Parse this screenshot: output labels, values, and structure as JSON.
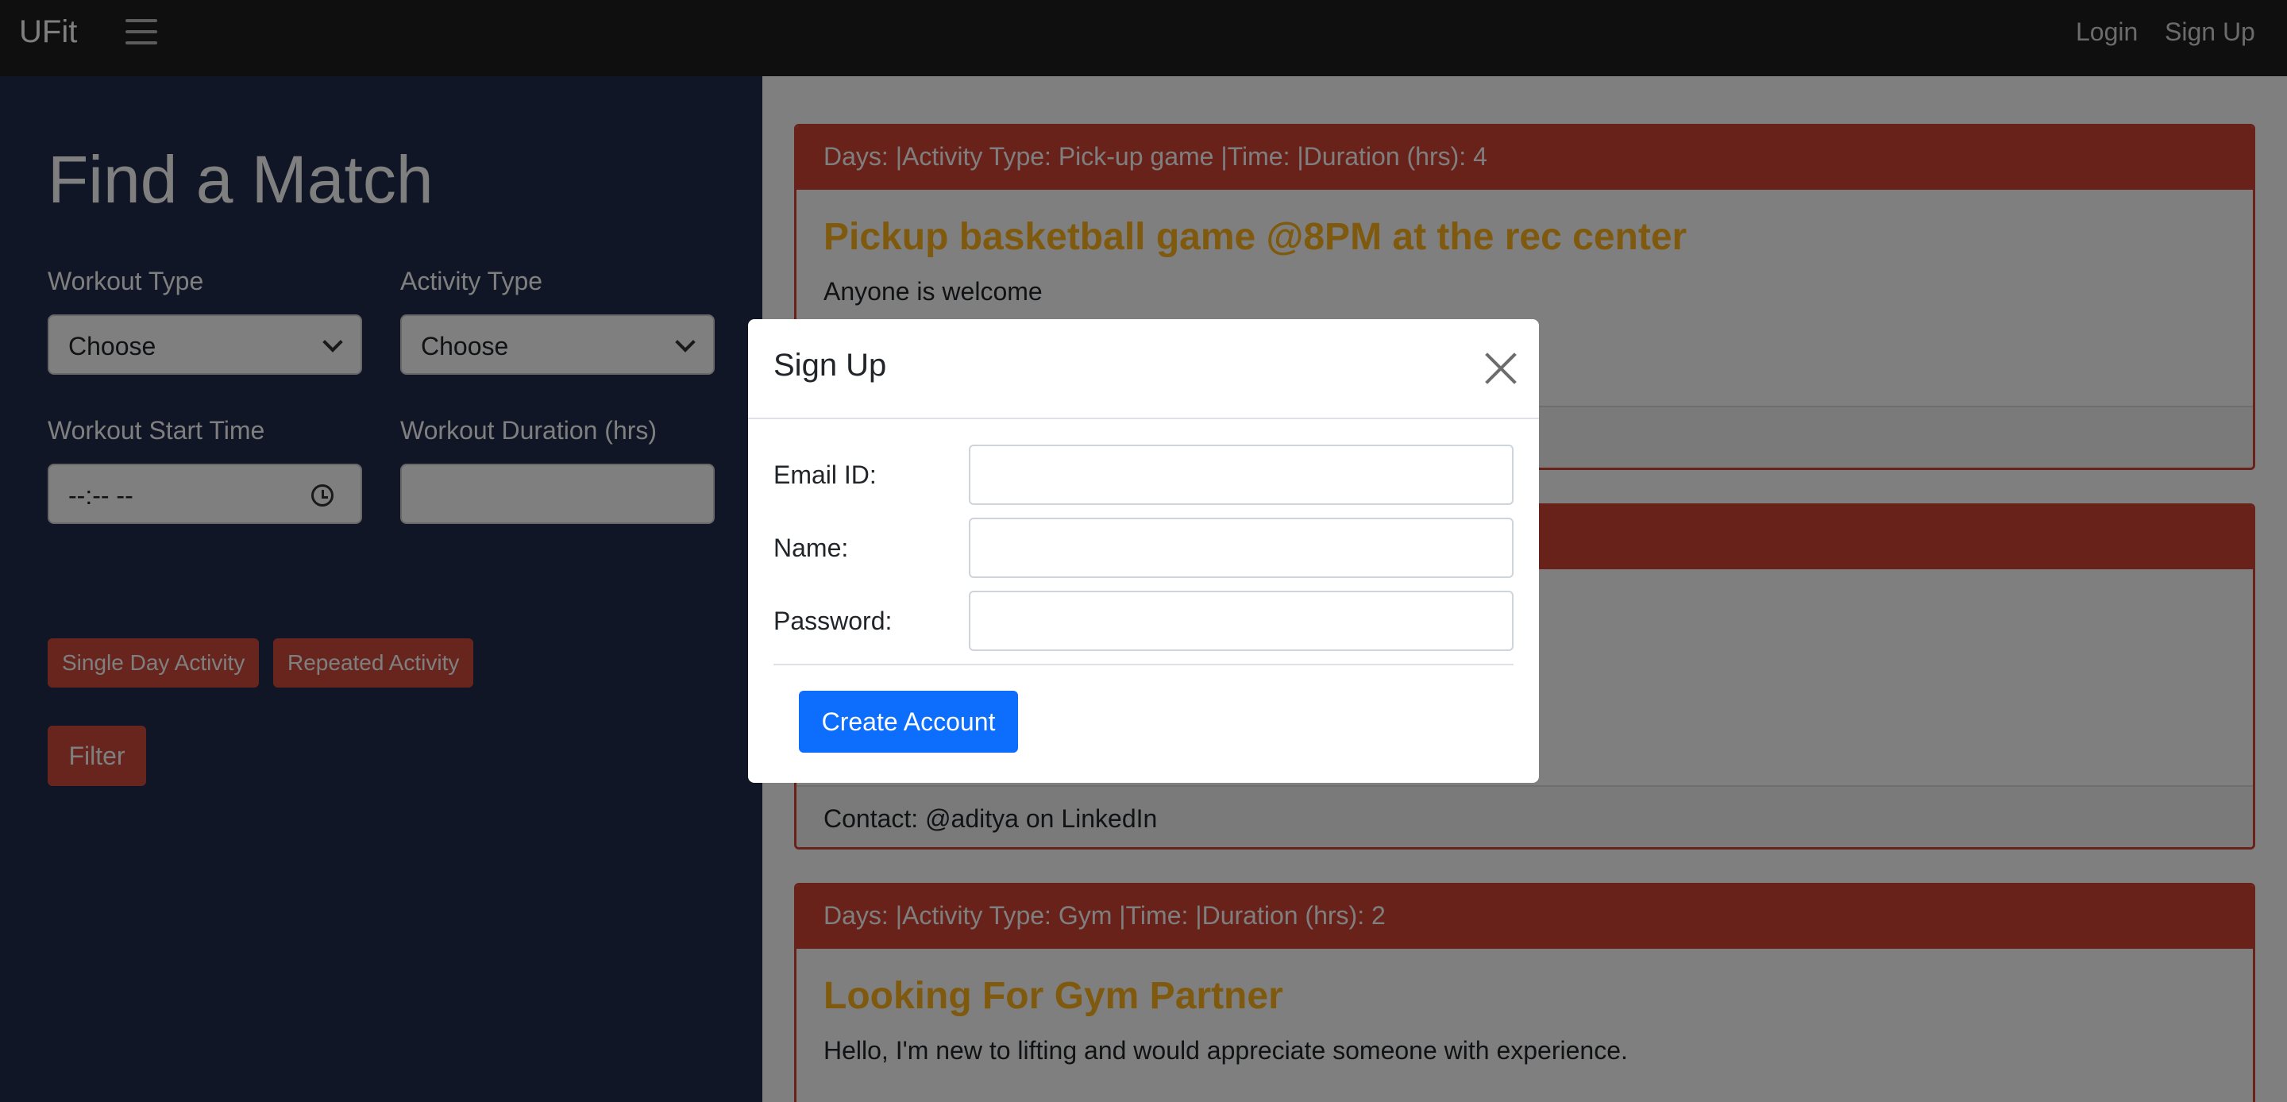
{
  "navbar": {
    "brand": "UFit",
    "login": "Login",
    "signup": "Sign Up"
  },
  "sidebar": {
    "title": "Find a Match",
    "workout_type_label": "Workout Type",
    "workout_type_value": "Choose",
    "activity_type_label": "Activity Type",
    "activity_type_value": "Choose",
    "start_time_label": "Workout Start Time",
    "start_time_value": "--:-- --",
    "duration_label": "Workout Duration (hrs)",
    "single_day_label": "Single Day Activity",
    "repeated_label": "Repeated Activity",
    "filter_label": "Filter"
  },
  "cards": [
    {
      "header": "Days: |Activity Type: Pick-up game |Time: |Duration (hrs): 4",
      "title": "Pickup basketball game @8PM at the rec center",
      "text": "Anyone is welcome"
    },
    {
      "footer": "Contact: @aditya on LinkedIn"
    },
    {
      "header": "Days: |Activity Type: Gym |Time: |Duration (hrs): 2",
      "title": "Looking For Gym Partner",
      "text": "Hello, I'm new to lifting and would appreciate someone with experience."
    }
  ],
  "modal": {
    "title": "Sign Up",
    "email_label": "Email ID:",
    "email_value": "",
    "name_label": "Name:",
    "name_value": "",
    "password_label": "Password:",
    "password_value": "",
    "create_label": "Create Account"
  },
  "colors": {
    "accent": "#d24534",
    "title_gold": "#ffb31a",
    "primary_button": "#0d6efd",
    "sidebar_bg": "#212d4a"
  }
}
